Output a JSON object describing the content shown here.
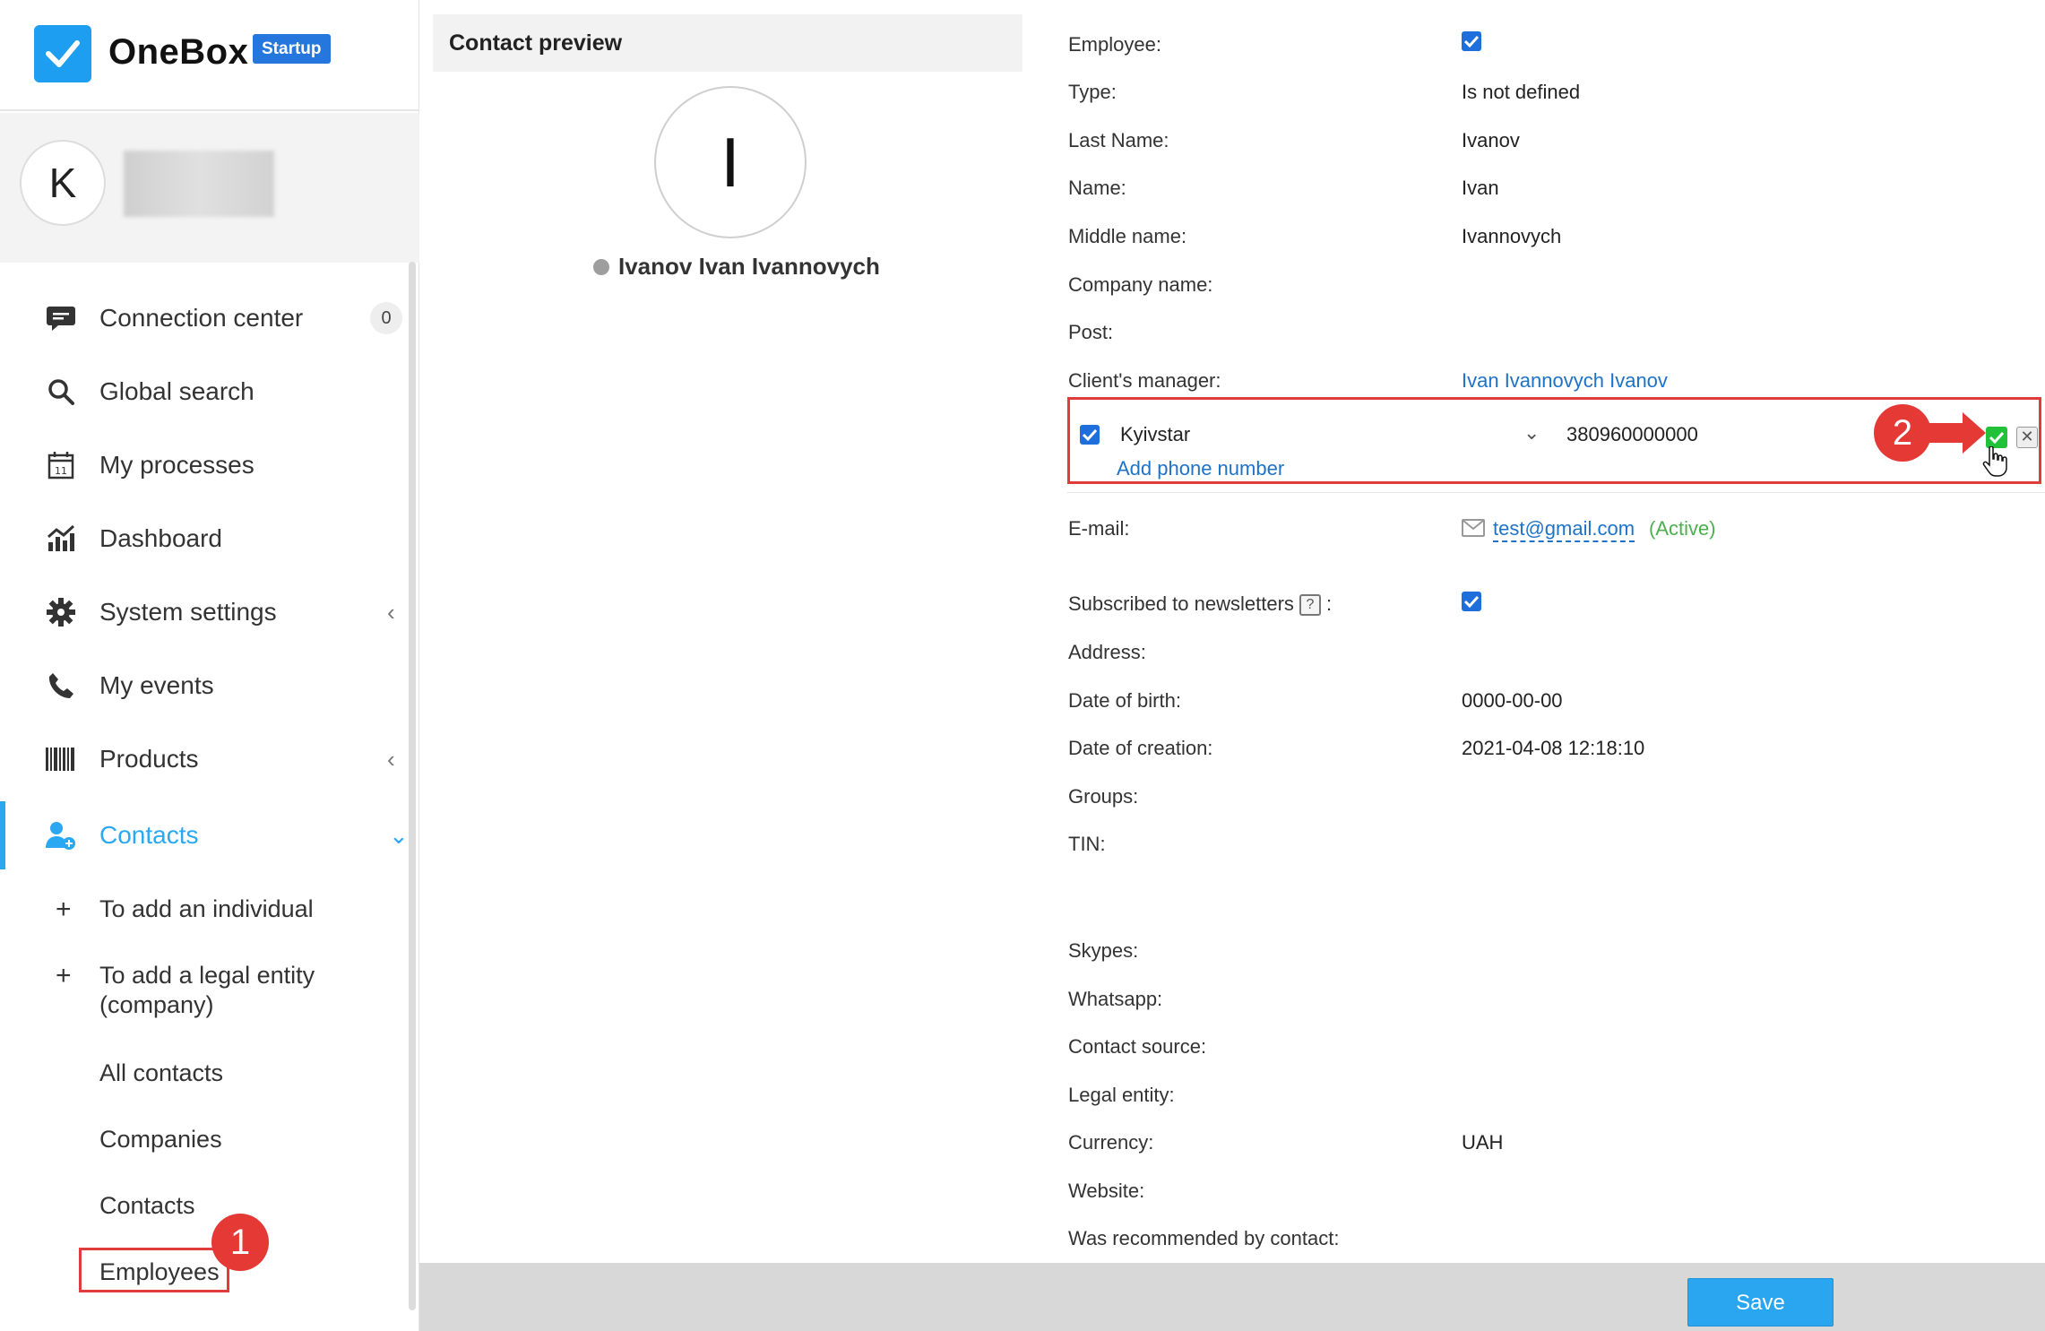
{
  "app": {
    "name": "OneBox",
    "plan_badge": "Startup"
  },
  "user": {
    "avatar_letter": "K"
  },
  "menu": {
    "connection_center": "Connection center",
    "connection_center_count": "0",
    "global_search": "Global search",
    "my_processes": "My processes",
    "dashboard": "Dashboard",
    "system_settings": "System settings",
    "my_events": "My events",
    "products": "Products",
    "contacts": "Contacts"
  },
  "submenu": {
    "add_individual": "To add an individual",
    "add_legal_entity_line1": "To add a legal entity",
    "add_legal_entity_line2": "(company)",
    "all_contacts": "All contacts",
    "companies": "Companies",
    "contacts": "Contacts",
    "employees": "Employees"
  },
  "annotations": {
    "one": "1",
    "two": "2"
  },
  "preview": {
    "title": "Contact preview",
    "avatar_letter": "I",
    "full_name": "Ivanov Ivan Ivannovych"
  },
  "fields": {
    "employee_label": "Employee:",
    "type_label": "Type:",
    "type_value": "Is not defined",
    "last_name_label": "Last Name:",
    "last_name_value": "Ivanov",
    "name_label": "Name:",
    "name_value": "Ivan",
    "middle_name_label": "Middle name:",
    "middle_name_value": "Ivannovych",
    "company_name_label": "Company name:",
    "post_label": "Post:",
    "clients_manager_label": "Client's manager:",
    "clients_manager_value": "Ivan Ivannovych Ivanov",
    "email_label": "E-mail:",
    "email_value": "test@gmail.com",
    "email_status": "(Active)",
    "subscribed_label": "Subscribed to newsletters",
    "subscribed_help": "?",
    "subscribed_colon": ":",
    "address_label": "Address:",
    "dob_label": "Date of birth:",
    "dob_value": "0000-00-00",
    "creation_label": "Date of creation:",
    "creation_value": "2021-04-08 12:18:10",
    "groups_label": "Groups:",
    "tin_label": "TIN:",
    "skypes_label": "Skypes:",
    "whatsapp_label": "Whatsapp:",
    "source_label": "Contact source:",
    "legal_entity_label": "Legal entity:",
    "currency_label": "Currency:",
    "currency_value": "UAH",
    "website_label": "Website:",
    "recommended_label": "Was recommended by contact:"
  },
  "phone": {
    "operator": "Kyivstar",
    "number": "380960000000",
    "add_label": "Add phone number",
    "cancel_glyph": "✕"
  },
  "footer": {
    "save_label": "Save"
  },
  "colors": {
    "accent": "#2aa8f2",
    "annotation": "#e53935",
    "link": "#1e73c7",
    "active_status": "#4caf50"
  }
}
